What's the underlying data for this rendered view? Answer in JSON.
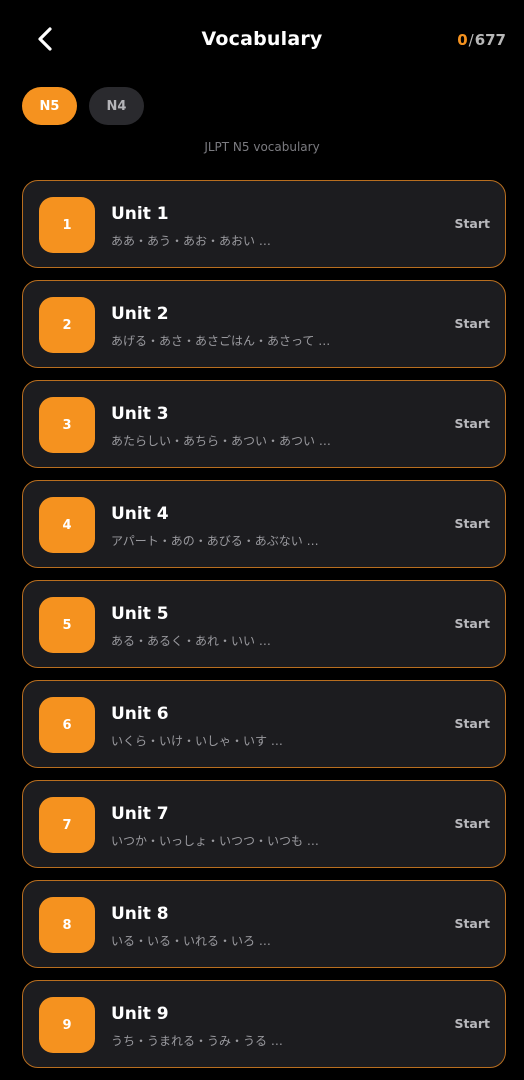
{
  "header": {
    "title": "Vocabulary",
    "progress_done": "0",
    "progress_total": "677"
  },
  "levels": [
    {
      "label": "N5",
      "active": true
    },
    {
      "label": "N4",
      "active": false
    }
  ],
  "subtitle": "JLPT N5 vocabulary",
  "units": [
    {
      "number": "1",
      "title": "Unit 1",
      "words": "ああ・あう・あお・あおい …",
      "action": "Start"
    },
    {
      "number": "2",
      "title": "Unit 2",
      "words": "あげる・あさ・あさごはん・あさって …",
      "action": "Start"
    },
    {
      "number": "3",
      "title": "Unit 3",
      "words": "あたらしい・あちら・あつい・あつい …",
      "action": "Start"
    },
    {
      "number": "4",
      "title": "Unit 4",
      "words": "アパート・あの・あびる・あぶない …",
      "action": "Start"
    },
    {
      "number": "5",
      "title": "Unit 5",
      "words": "ある・あるく・あれ・いい …",
      "action": "Start"
    },
    {
      "number": "6",
      "title": "Unit 6",
      "words": "いくら・いけ・いしゃ・いす …",
      "action": "Start"
    },
    {
      "number": "7",
      "title": "Unit 7",
      "words": "いつか・いっしょ・いつつ・いつも …",
      "action": "Start"
    },
    {
      "number": "8",
      "title": "Unit 8",
      "words": "いる・いる・いれる・いろ …",
      "action": "Start"
    },
    {
      "number": "9",
      "title": "Unit 9",
      "words": "うち・うまれる・うみ・うる …",
      "action": "Start"
    }
  ],
  "colors": {
    "accent": "#f5921f",
    "background": "#000000",
    "card": "#1c1c1f",
    "card_border": "#b86e1f"
  },
  "icons": {
    "back": "chevron-left-icon"
  }
}
